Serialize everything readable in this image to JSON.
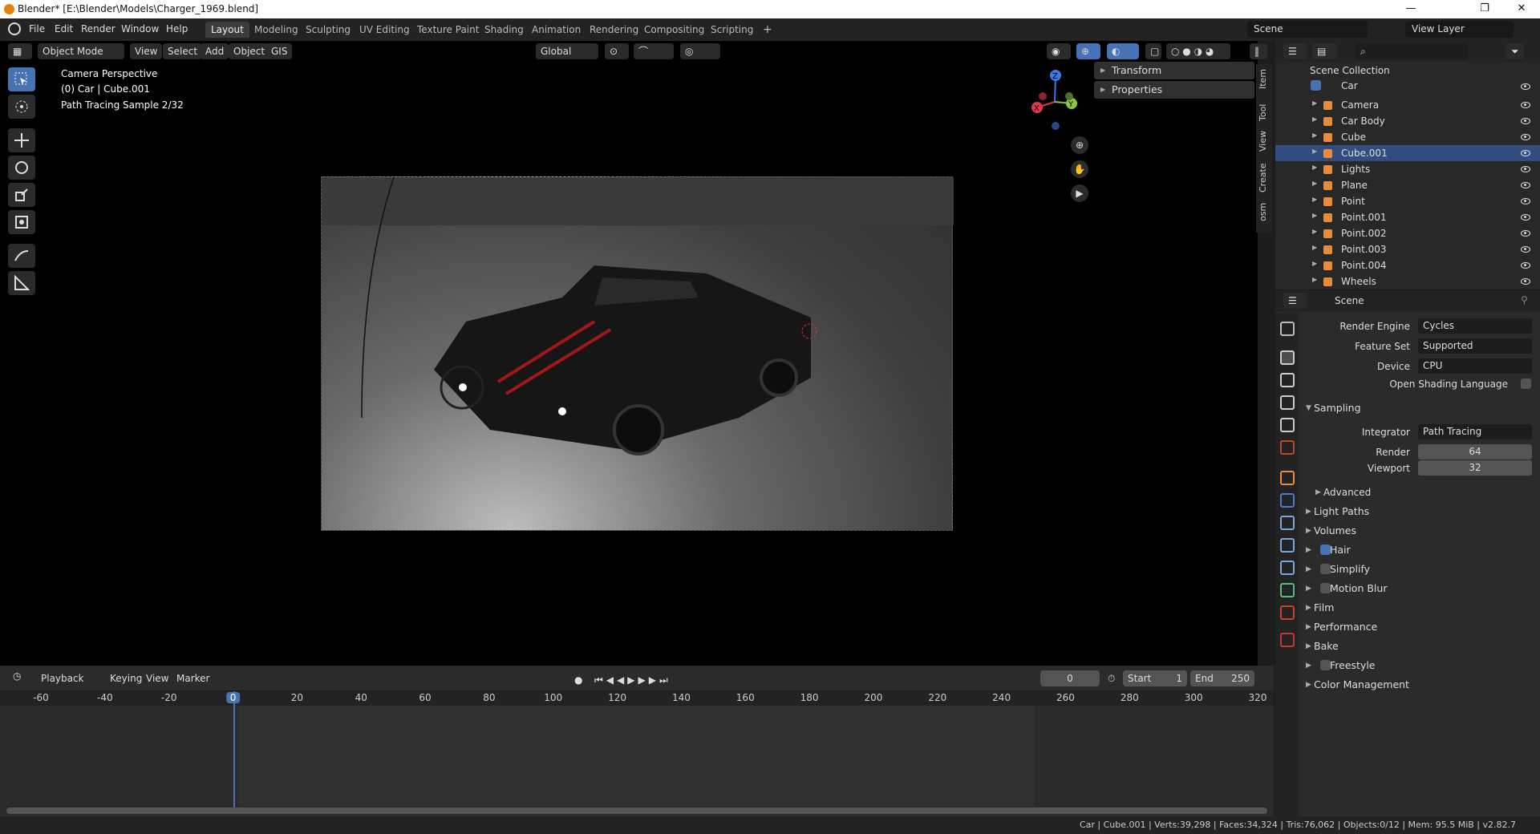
{
  "window": {
    "title": "Blender* [E:\\Blender\\Models\\Charger_1969.blend]",
    "minimize": "—",
    "maximize": "❐",
    "close": "✕"
  },
  "menu": [
    "File",
    "Edit",
    "Render",
    "Window",
    "Help"
  ],
  "workspaces": [
    "Layout",
    "Modeling",
    "Sculpting",
    "UV Editing",
    "Texture Paint",
    "Shading",
    "Animation",
    "Rendering",
    "Compositing",
    "Scripting"
  ],
  "top_right": {
    "scene": "Scene",
    "view_layer": "View Layer"
  },
  "viewport": {
    "mode": "Object Mode",
    "menus": [
      "View",
      "Select",
      "Add",
      "Object",
      "GIS"
    ],
    "transform": "Global",
    "overlay": [
      "Camera Perspective",
      "(0) Car | Cube.001",
      "Path Tracing Sample 2/32"
    ],
    "npanel": [
      "Transform",
      "Properties"
    ],
    "side_tabs": [
      "Item",
      "Tool",
      "View",
      "Create",
      "osm"
    ],
    "gizmo": {
      "x": "X",
      "y": "Y",
      "z": "Z"
    }
  },
  "timeline": {
    "menus": [
      "Playback",
      "Keying",
      "View",
      "Marker"
    ],
    "current_frame": "0",
    "start_label": "Start",
    "start": "1",
    "end_label": "End",
    "end": "250",
    "ticks": [
      "-60",
      "-40",
      "-20",
      "0",
      "20",
      "40",
      "60",
      "80",
      "100",
      "120",
      "140",
      "160",
      "180",
      "200",
      "220",
      "240",
      "260",
      "280",
      "300",
      "320"
    ]
  },
  "status": "Car | Cube.001 | Verts:39,298 | Faces:34,324 | Tris:76,062 | Objects:0/12 | Mem: 95.5 MiB | v2.82.7",
  "outliner": {
    "root": "Scene Collection",
    "collection": "Car",
    "items": [
      "Camera",
      "Car Body",
      "Cube",
      "Cube.001",
      "Lights",
      "Plane",
      "Point",
      "Point.001",
      "Point.002",
      "Point.003",
      "Point.004",
      "Wheels"
    ]
  },
  "properties": {
    "context": "Scene",
    "render_engine_label": "Render Engine",
    "render_engine": "Cycles",
    "feature_set_label": "Feature Set",
    "feature_set": "Supported",
    "device_label": "Device",
    "device": "CPU",
    "osl": "Open Shading Language",
    "sampling": "Sampling",
    "integrator_label": "Integrator",
    "integrator": "Path Tracing",
    "render_label": "Render",
    "render": "64",
    "viewport_label": "Viewport",
    "viewport": "32",
    "advanced": "Advanced",
    "sections": [
      "Light Paths",
      "Volumes",
      "Hair",
      "Simplify",
      "Motion Blur",
      "Film",
      "Performance",
      "Bake",
      "Freestyle",
      "Color Management"
    ]
  },
  "colors": {
    "accent": "#4772b3",
    "orange": "#e87d0d"
  }
}
